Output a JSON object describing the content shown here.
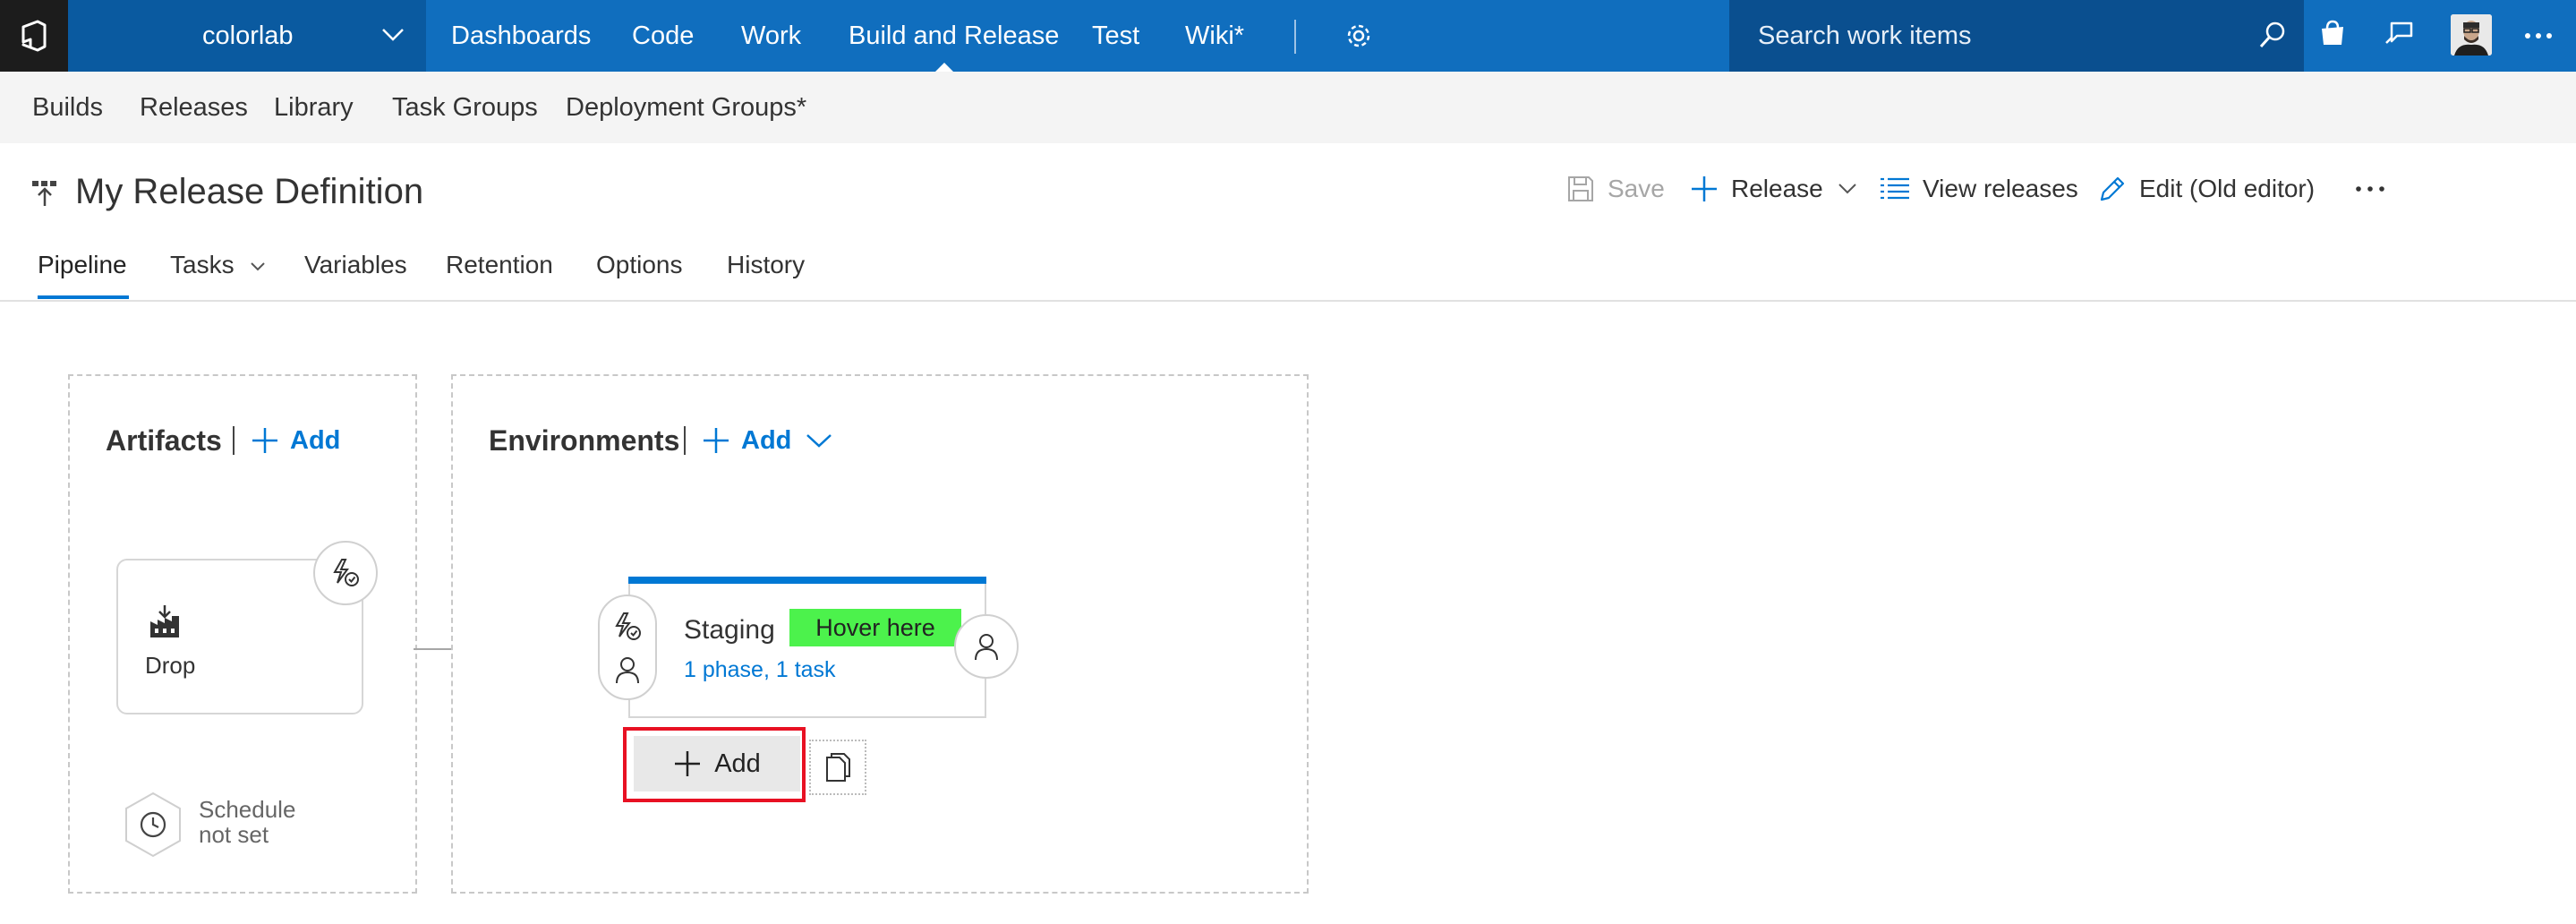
{
  "colors": {
    "topbar": "#106ebe",
    "accent": "#0078d4",
    "hover_tag": "#4cf24c",
    "highlight_outline": "#e81123"
  },
  "topbar": {
    "project": "colorlab",
    "nav": [
      "Dashboards",
      "Code",
      "Work",
      "Build and Release",
      "Test",
      "Wiki*"
    ],
    "active_nav": "Build and Release",
    "search_placeholder": "Search work items",
    "icons": [
      "vsts-logo-icon",
      "chevron-down-icon",
      "gear-icon",
      "search-icon",
      "shopping-bag-icon",
      "feedback-icon",
      "avatar",
      "more-icon"
    ]
  },
  "subnav": [
    "Builds",
    "Releases",
    "Library",
    "Task Groups",
    "Deployment Groups*"
  ],
  "header": {
    "title": "My Release Definition",
    "save": "Save",
    "release": "Release",
    "view_releases": "View releases",
    "edit_old": "Edit (Old editor)"
  },
  "tabs": [
    "Pipeline",
    "Tasks",
    "Variables",
    "Retention",
    "Options",
    "History"
  ],
  "active_tab": "Pipeline",
  "artifacts": {
    "title": "Artifacts",
    "add": "Add",
    "card_label": "Drop",
    "schedule_line1": "Schedule",
    "schedule_line2": "not set"
  },
  "environments": {
    "title": "Environments",
    "add": "Add",
    "env_name": "Staging",
    "hover_tag": "Hover here",
    "env_summary": "1 phase, 1 task",
    "add_button": "Add"
  }
}
